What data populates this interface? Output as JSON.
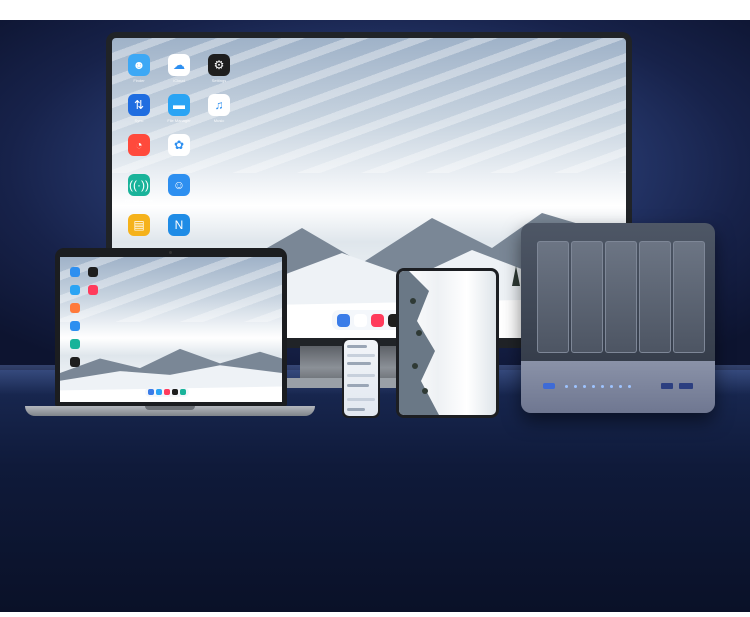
{
  "monitor": {
    "icons": [
      {
        "name": "finder-icon",
        "label": "Finder",
        "color": "#3da8f5",
        "glyph": "☻"
      },
      {
        "name": "icloud-icon",
        "label": "iCloud",
        "color": "#ffffff",
        "glyph": "☁"
      },
      {
        "name": "settings-icon",
        "label": "Settings",
        "color": "#1e1e1e",
        "glyph": "⚙"
      },
      {
        "name": "transfer-icon",
        "label": "Sync",
        "color": "#1f6de0",
        "glyph": "⇅"
      },
      {
        "name": "folder-icon",
        "label": "File Manager",
        "color": "#2aa4f4",
        "glyph": "▬"
      },
      {
        "name": "music-icon",
        "label": "Music",
        "color": "#ffffff",
        "glyph": "♫"
      },
      {
        "name": "speedtest-icon",
        "label": "",
        "color": "#ff4a3c",
        "glyph": "◔"
      },
      {
        "name": "photos-icon",
        "label": "",
        "color": "#ffffff",
        "glyph": "✿"
      },
      {
        "name": "remote-access-icon",
        "label": "Remote Access",
        "color": "#19b39a",
        "glyph": "((·))"
      },
      {
        "name": "chat-icon",
        "label": "",
        "color": "#2d8ff0",
        "glyph": "☺"
      },
      {
        "name": "presentation-icon",
        "label": "",
        "color": "#f5b21b",
        "glyph": "▤"
      },
      {
        "name": "notes-icon",
        "label": "",
        "color": "#1f8ce6",
        "glyph": "N"
      }
    ],
    "dock_colors": [
      "#3a7ce8",
      "#ffffff",
      "#ff3b5c",
      "#1e1e1e"
    ]
  },
  "laptop": {
    "icons": [
      "#2d8ff0",
      "#1e1e1e",
      "#2aa4f4",
      "#ff3b5c",
      "#ff7a3c",
      "#2d8ff0",
      "#19b39a",
      "#1e1e1e"
    ],
    "dock_colors": [
      "#3a7ce8",
      "#2aa4f4",
      "#ff3b5c",
      "#1e1e1e",
      "#19b39a"
    ]
  },
  "nas": {
    "bays": 5,
    "status_led_color": "#9ec3ff"
  }
}
